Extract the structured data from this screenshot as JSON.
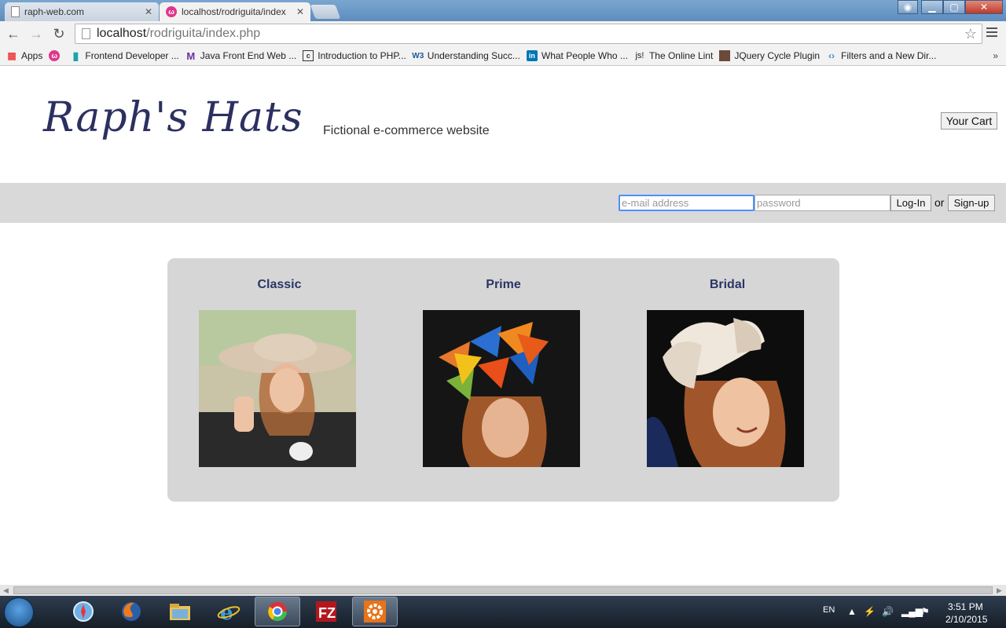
{
  "browser": {
    "tabs": [
      {
        "title": "raph-web.com",
        "active": false
      },
      {
        "title": "localhost/rodriguita/index",
        "active": true
      }
    ],
    "url_host": "localhost",
    "url_path": "/rodriguita/index.php",
    "bookmarks": [
      {
        "label": "Apps",
        "icon": "apps-grid-icon"
      },
      {
        "label": "",
        "icon": "pink-circle-icon"
      },
      {
        "label": "Frontend Developer ...",
        "icon": "teal-bookmark-icon"
      },
      {
        "label": "Java Front End Web ...",
        "icon": "purple-m-icon"
      },
      {
        "label": "Introduction to PHP...",
        "icon": "page-c-icon"
      },
      {
        "label": "Understanding Succ...",
        "icon": "w3-icon"
      },
      {
        "label": "What People Who ...",
        "icon": "linkedin-icon"
      },
      {
        "label": "The Online Lint",
        "icon": "js-icon"
      },
      {
        "label": "JQuery Cycle Plugin",
        "icon": "photo-icon"
      },
      {
        "label": "Filters and a New Dir...",
        "icon": "code-icon"
      }
    ],
    "bookmarks_more": "»"
  },
  "site": {
    "logo": "Raph's Hats",
    "tagline": "Fictional e-commerce website",
    "cart_label": "Your Cart",
    "login": {
      "email_placeholder": "e-mail address",
      "password_placeholder": "password",
      "login_label": "Log-In",
      "or_text": "or",
      "signup_label": "Sign-up"
    },
    "categories": [
      {
        "title": "Classic"
      },
      {
        "title": "Prime"
      },
      {
        "title": "Bridal"
      }
    ]
  },
  "taskbar": {
    "language": "EN",
    "time": "3:51 PM",
    "date": "2/10/2015"
  },
  "colors": {
    "accent_title": "#2b3566",
    "login_bar": "#d9d9d9",
    "gallery_bg": "#d6d6d6"
  }
}
